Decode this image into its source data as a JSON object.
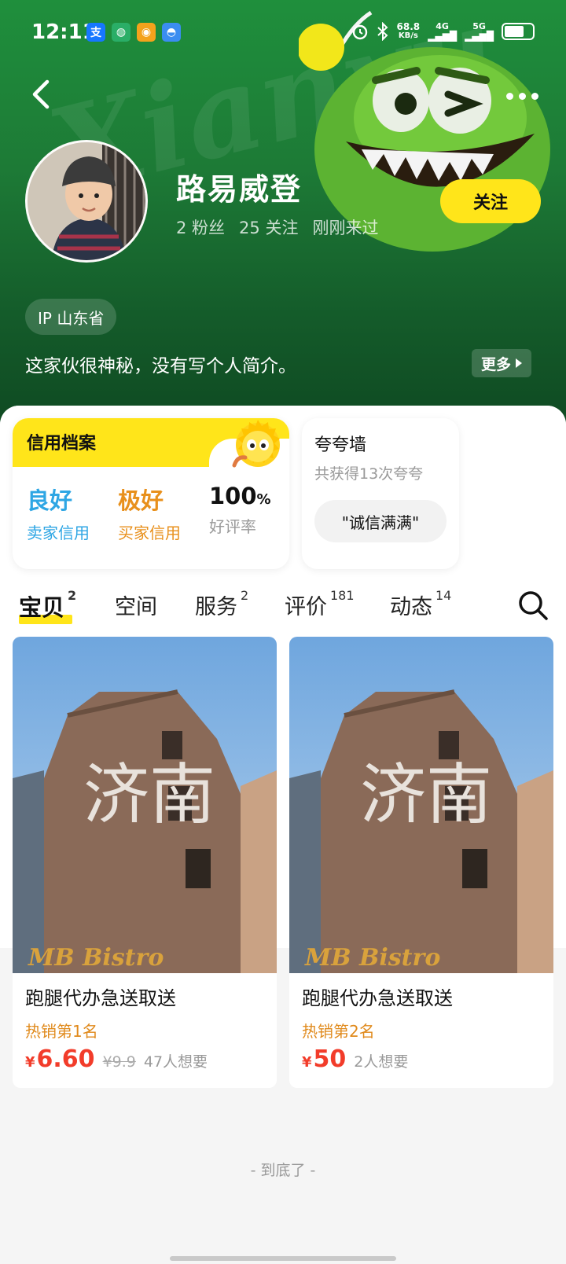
{
  "status_bar": {
    "time": "12:11",
    "notif_icons": [
      {
        "name": "alipay-icon",
        "glyph": "支",
        "color": "#1677ff"
      },
      {
        "name": "wechat-icon",
        "glyph": "◍",
        "color": "#2aae67"
      },
      {
        "name": "weibo-icon",
        "glyph": "◉",
        "color": "#f4a21c"
      },
      {
        "name": "chat-app-icon",
        "glyph": "◓",
        "color": "#3b8df1"
      }
    ],
    "net_speed": "68.8",
    "net_unit": "KB/s",
    "net_4g": "4G",
    "net_5g": "5G"
  },
  "profile": {
    "username": "路易威登",
    "fans": "2 粉丝",
    "following": "25 关注",
    "last_visit": "刚刚来过",
    "follow_label": "关注",
    "ip_location": "IP 山东省",
    "bio": "这家伙很神秘，没有写个人简介。",
    "more_label": "更多"
  },
  "credit": {
    "title": "信用档案",
    "seller_value": "良好",
    "seller_label": "卖家信用",
    "buyer_value": "极好",
    "buyer_label": "买家信用",
    "rate_value": "100",
    "rate_pct": "%",
    "rate_label": "好评率",
    "colors": {
      "seller": "#2ea6e4",
      "buyer": "#e8901c"
    }
  },
  "praise": {
    "title": "夸夸墙",
    "subtitle": "共获得13次夸夸",
    "tag": "\"诚信满满\""
  },
  "tabs": [
    {
      "label": "宝贝",
      "count": "2"
    },
    {
      "label": "空间",
      "count": ""
    },
    {
      "label": "服务",
      "count": "2"
    },
    {
      "label": "评价",
      "count": "181"
    },
    {
      "label": "动态",
      "count": "14"
    }
  ],
  "items": [
    {
      "title": "跑腿代办急送取送",
      "rank": "热销第1名",
      "currency": "¥",
      "price": "6.60",
      "orig_price": "¥9.9",
      "wants": "47人想要",
      "sign_text": "济南",
      "sign_sub": "MB Bistro"
    },
    {
      "title": "跑腿代办急送取送",
      "rank": "热销第2名",
      "currency": "¥",
      "price": "50",
      "orig_price": "",
      "wants": "2人想要",
      "sign_text": "济南",
      "sign_sub": "MB Bistro"
    }
  ],
  "footer": {
    "end_text": "- 到底了 -"
  }
}
